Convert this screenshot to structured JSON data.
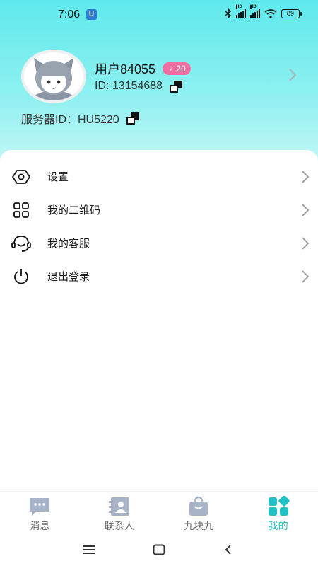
{
  "status_bar": {
    "time": "7:06",
    "battery": "89",
    "signal_label": "HD"
  },
  "profile": {
    "username": "用户84055",
    "gender_badge": "♀ 20",
    "id_text": "ID: 13154688",
    "server_id_text": "服务器ID：HU5220"
  },
  "menu": {
    "items": [
      {
        "label": "设置",
        "icon": "settings-icon"
      },
      {
        "label": "我的二维码",
        "icon": "qrcode-icon"
      },
      {
        "label": "我的客服",
        "icon": "headset-icon"
      },
      {
        "label": "退出登录",
        "icon": "power-icon"
      }
    ]
  },
  "tabs": [
    {
      "label": "消息",
      "icon": "message-icon",
      "active": false
    },
    {
      "label": "联系人",
      "icon": "contacts-icon",
      "active": false
    },
    {
      "label": "九块九",
      "icon": "shopping-bag-icon",
      "active": false
    },
    {
      "label": "我的",
      "icon": "profile-grid-icon",
      "active": true
    }
  ],
  "colors": {
    "accent": "#20c2c6",
    "header_gradient_top": "#5fe9ec",
    "badge_pink": "#f06ea2",
    "tab_inactive": "#a9b3c7"
  }
}
